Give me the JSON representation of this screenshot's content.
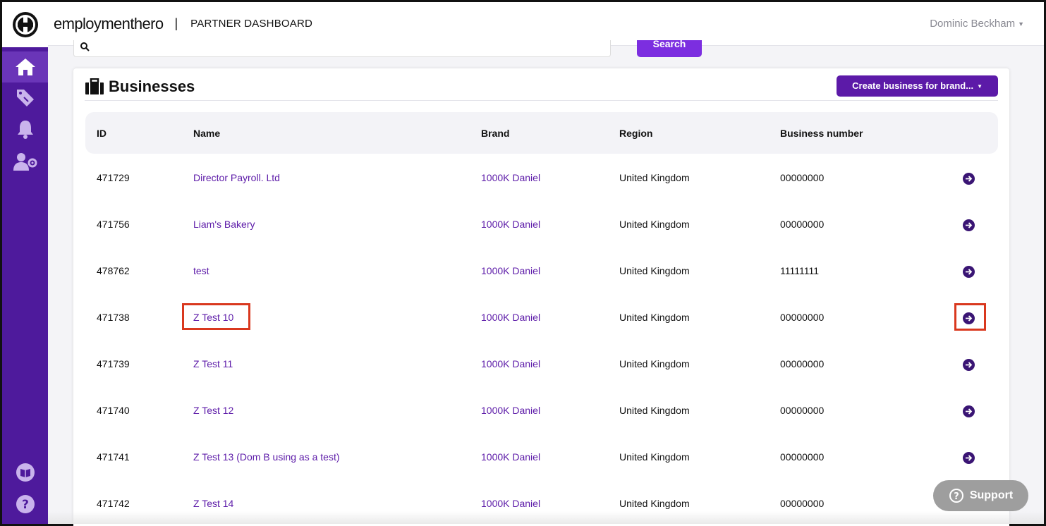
{
  "header": {
    "brand": "employmenthero",
    "separator": "|",
    "title": "PARTNER DASHBOARD",
    "user": "Dominic Beckham"
  },
  "search": {
    "button_label": "Search"
  },
  "card": {
    "title": "Businesses",
    "create_button": "Create business for brand..."
  },
  "table": {
    "headers": [
      "ID",
      "Name",
      "Brand",
      "Region",
      "Business number"
    ],
    "rows": [
      {
        "id": "471729",
        "name": "Director Payroll. Ltd",
        "brand": "1000K Daniel",
        "region": "United Kingdom",
        "number": "00000000"
      },
      {
        "id": "471756",
        "name": "Liam's Bakery",
        "brand": "1000K Daniel",
        "region": "United Kingdom",
        "number": "00000000"
      },
      {
        "id": "478762",
        "name": "test",
        "brand": "1000K Daniel",
        "region": "United Kingdom",
        "number": "11111111"
      },
      {
        "id": "471738",
        "name": "Z Test 10",
        "brand": "1000K Daniel",
        "region": "United Kingdom",
        "number": "00000000"
      },
      {
        "id": "471739",
        "name": "Z Test 11",
        "brand": "1000K Daniel",
        "region": "United Kingdom",
        "number": "00000000"
      },
      {
        "id": "471740",
        "name": "Z Test 12",
        "brand": "1000K Daniel",
        "region": "United Kingdom",
        "number": "00000000"
      },
      {
        "id": "471741",
        "name": "Z Test 13 (Dom B using as a test)",
        "brand": "1000K Daniel",
        "region": "United Kingdom",
        "number": "00000000"
      },
      {
        "id": "471742",
        "name": "Z Test 14",
        "brand": "1000K Daniel",
        "region": "United Kingdom",
        "number": "00000000"
      }
    ]
  },
  "support": {
    "label": "Support"
  },
  "colors": {
    "sidebar": "#4e1a9c",
    "accent": "#5c1aa8",
    "highlight": "#d9381e"
  },
  "icons": [
    "home-icon",
    "tag-icon",
    "bell-icon",
    "user-settings-icon",
    "book-icon",
    "help-icon",
    "search-icon",
    "briefcase-icon",
    "arrow-right-circle-icon"
  ]
}
